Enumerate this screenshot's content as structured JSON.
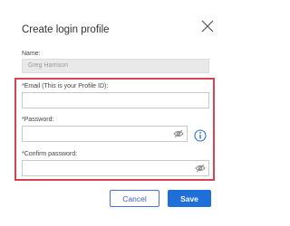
{
  "dialog": {
    "title": "Create login profile",
    "close_icon": "close-icon"
  },
  "name": {
    "label": "Name:",
    "value": "Greg Harrison"
  },
  "email": {
    "label": "*Email (This is your Profile ID):",
    "value": ""
  },
  "password": {
    "label": "*Password:",
    "value": "",
    "icon": "eye-off-icon"
  },
  "confirm_password": {
    "label": "*Confirm password:",
    "value": "",
    "icon": "eye-off-icon"
  },
  "info_icon": "info-icon",
  "buttons": {
    "cancel": "Cancel",
    "save": "Save"
  },
  "colors": {
    "highlight_border": "#d9434f",
    "primary": "#1f6fd8",
    "link": "#3a5fc8"
  }
}
